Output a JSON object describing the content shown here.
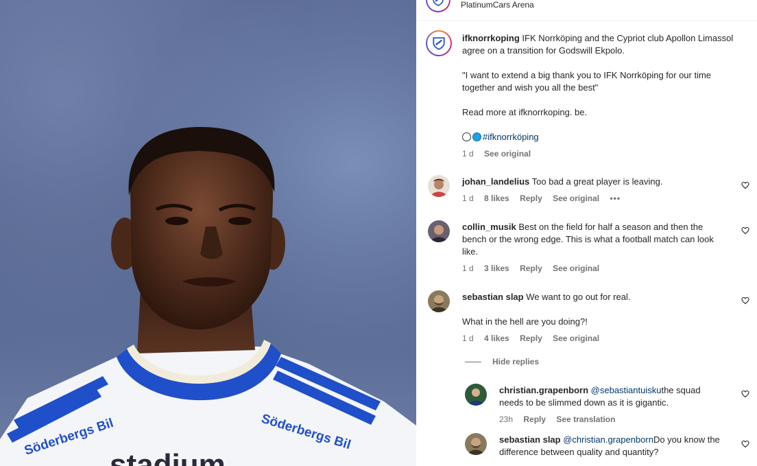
{
  "post": {
    "location": "PlatinumCars Arena",
    "author": "ifknorrkoping",
    "caption": {
      "text1": "IFK Norrköping and the Cypriot club Apollon Limassol agree on a transition for Godswill Ekpolo.",
      "quote": "\"I want to extend a big thank you to IFK Norrköping for our time together and wish you all the best\"",
      "readmore": "Read more at ifknorrkoping. be.",
      "hashtag": "#ifknorrköping"
    },
    "time": "1 d",
    "see_original": "See original"
  },
  "jersey": {
    "sponsor": "Söderbergs Bil",
    "chest": "stadium"
  },
  "comments": [
    {
      "user": "johan_landelius",
      "text": "Too bad a great player is leaving.",
      "time": "1 d",
      "likes": "8 likes",
      "reply": "Reply",
      "translate": "See original",
      "more": "•••"
    },
    {
      "user": "collin_musik",
      "text": "Best on the field for half a season and then the bench or the wrong edge. This is what a football match can look like.",
      "time": "1 d",
      "likes": "3 likes",
      "reply": "Reply",
      "translate": "See original"
    },
    {
      "user": "sebastian slap",
      "text": "We want to go out for real.",
      "text2": "What in the hell are you doing?!",
      "time": "1 d",
      "likes": "4 likes",
      "reply": "Reply",
      "translate": "See original"
    }
  ],
  "hide_replies": "Hide replies",
  "replies": [
    {
      "user": "christian.grapenborn",
      "mention": "@sebastiantuisku",
      "text": "the squad needs to be slimmed down as it is gigantic.",
      "time": "23h",
      "reply": "Reply",
      "translate": "See translation"
    },
    {
      "user": "sebastian slap",
      "mention": "@christian.grapenborn",
      "text": "Do you know the difference between quality and quantity?"
    }
  ],
  "colors": {
    "link": "#00376b",
    "secondary": "#737373",
    "jersey_blue": "#1f4fc9"
  }
}
